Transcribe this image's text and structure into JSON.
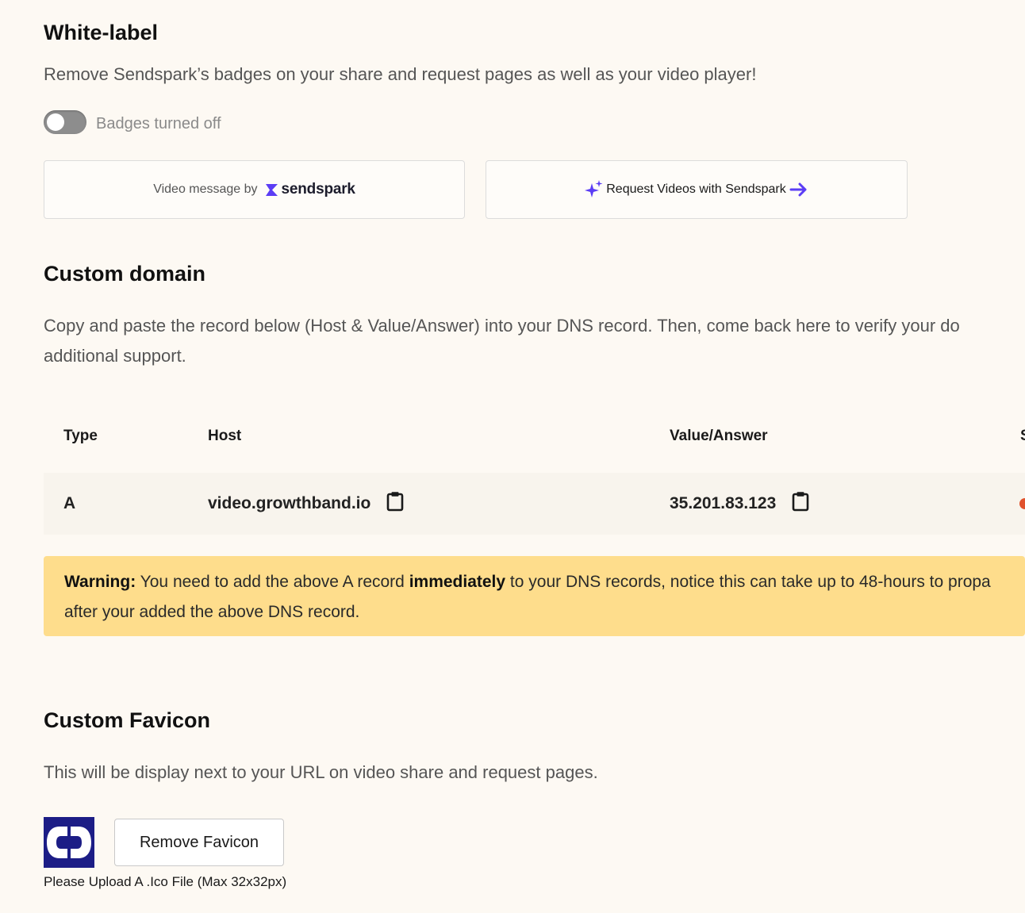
{
  "whitelabel": {
    "title": "White-label",
    "description": "Remove Sendspark’s badges on your share and request pages as well as your video player!",
    "toggle_label": "Badges turned off",
    "toggle_on": false,
    "badge_prefix": "Video message by",
    "brand_name": "sendspark",
    "request_label": "Request Videos with Sendspark",
    "accent_color": "#5b3df5"
  },
  "custom_domain": {
    "title": "Custom domain",
    "description_line1": "Copy and paste the record below (Host & Value/Answer) into your DNS record. Then, come back here to verify your do",
    "description_line2": "additional support.",
    "table": {
      "headers": [
        "Type",
        "Host",
        "Value/Answer",
        "S"
      ],
      "rows": [
        {
          "type": "A",
          "host": "video.growthband.io",
          "value": "35.201.83.123",
          "status_color": "#e0522d"
        }
      ]
    },
    "warning": {
      "label": "Warning:",
      "text_before": " You need to add the above A record ",
      "emphasis": "immediately",
      "text_after": " to your DNS records, notice this can take up to 48-hours to propa",
      "line2": "after your added the above DNS record.",
      "bg_color": "#fedd8c"
    }
  },
  "favicon": {
    "title": "Custom Favicon",
    "description": "This will be display next to your URL on video share and request pages.",
    "remove_label": "Remove Favicon",
    "hint": "Please Upload A .Ico File (Max 32x32px)"
  }
}
